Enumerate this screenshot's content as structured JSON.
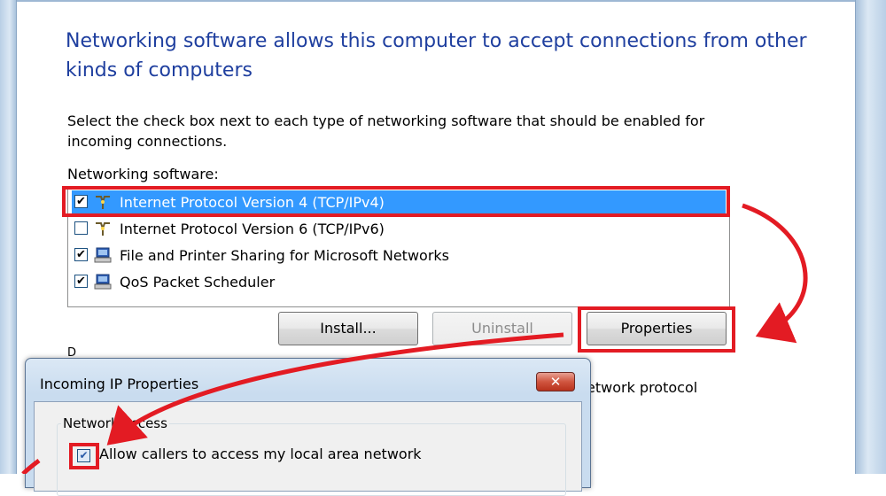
{
  "wizard": {
    "heading": "Networking software allows this computer to accept connections from other kinds of computers",
    "instructions": "Select the check box next to each type of networking software that should be enabled for incoming connections.",
    "list_label": "Networking software:",
    "items": [
      {
        "label": "Internet Protocol Version 4 (TCP/IPv4)",
        "checked": true,
        "selected": true,
        "icon": "network-protocol-icon"
      },
      {
        "label": "Internet Protocol Version 6 (TCP/IPv6)",
        "checked": false,
        "selected": false,
        "icon": "network-protocol-icon"
      },
      {
        "label": "File and Printer Sharing for Microsoft Networks",
        "checked": true,
        "selected": false,
        "icon": "network-service-icon"
      },
      {
        "label": "QoS Packet Scheduler",
        "checked": true,
        "selected": false,
        "icon": "network-service-icon"
      }
    ],
    "buttons": {
      "install": "Install...",
      "uninstall": "Uninstall",
      "properties": "Properties"
    },
    "partial_description": "etwork protocol",
    "partial_letter": "D"
  },
  "dialog": {
    "title": "Incoming IP Properties",
    "close_glyph": "✕",
    "group_label": "Network access",
    "allow_label": "Allow callers to access my local area network",
    "allow_checked": true
  },
  "check_glyph": "✔",
  "annotation_color": "#e31b23"
}
